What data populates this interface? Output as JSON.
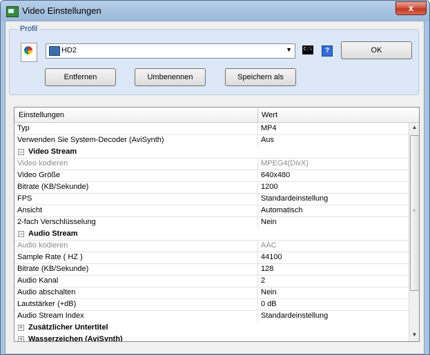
{
  "window": {
    "title": "Video Einstellungen",
    "close_label": "x"
  },
  "profil": {
    "group_label": "Profil",
    "selected": "HD2",
    "cmd_icon_text": "C:\\",
    "help_label": "?",
    "ok_label": "OK",
    "remove_label": "Entfernen",
    "rename_label": "Umbenennen",
    "saveas_label": "Speichern als"
  },
  "grid": {
    "col_settings": "Einstellungen",
    "col_value": "Wert",
    "rows": [
      {
        "key": "Typ",
        "value": "MP4"
      },
      {
        "key": "Verwenden Sie System-Decoder (AviSynth)",
        "value": "Aus"
      },
      {
        "key": "Video Stream",
        "value": "",
        "expander": "–"
      },
      {
        "key": "Video kodieren",
        "value": "MPEG4(DivX)"
      },
      {
        "key": "Video Größe",
        "value": "640x480"
      },
      {
        "key": "Bitrate (KB/Sekunde)",
        "value": "1200"
      },
      {
        "key": "FPS",
        "value": "Standardeinstellung"
      },
      {
        "key": "Ansicht",
        "value": "Automatisch"
      },
      {
        "key": "2-fach Verschlüsselung",
        "value": "Nein"
      },
      {
        "key": "Audio Stream",
        "value": "",
        "expander": "–"
      },
      {
        "key": "Audio kodieren",
        "value": "AAC"
      },
      {
        "key": "Sample Rate ( HZ )",
        "value": "44100"
      },
      {
        "key": "Bitrate (KB/Sekunde)",
        "value": "128"
      },
      {
        "key": "Audio Kanal",
        "value": "2"
      },
      {
        "key": "Audio abschalten",
        "value": "Nein"
      },
      {
        "key": "Lautstärker (+dB)",
        "value": "0 dB"
      },
      {
        "key": "Audio Stream Index",
        "value": "Standardeinstellung"
      },
      {
        "key": "Zusätzlicher Untertitel",
        "value": "",
        "expander": "+"
      },
      {
        "key": "Wasserzeichen (AviSynth)",
        "value": "",
        "expander": "+"
      }
    ]
  },
  "colors": {
    "title_bar": "#a9c4e2",
    "group_bg": "#dce8f5",
    "gray_text": "#8c8c8c"
  }
}
